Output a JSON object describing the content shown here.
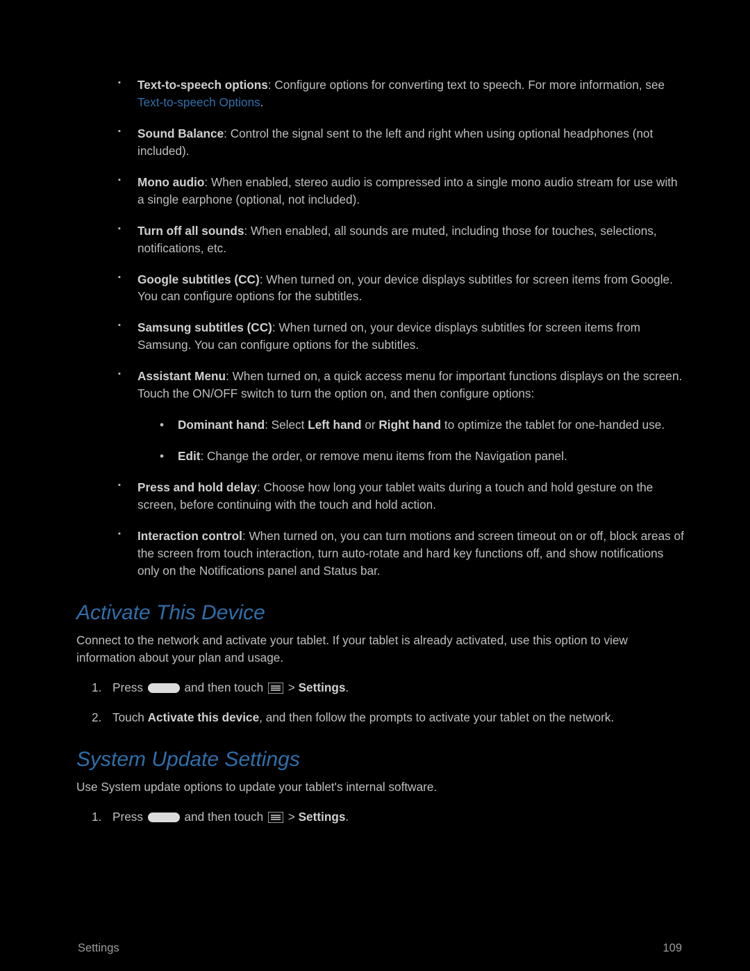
{
  "bullets": [
    {
      "term": "Text-to-speech options",
      "text_a": ": Configure options for converting text to speech. For more information, see ",
      "link": "Text-to-speech Options",
      "text_b": "."
    },
    {
      "term": "Sound Balance",
      "text": ": Control the signal sent to the left and right when using optional headphones (not included)."
    },
    {
      "term": "Mono audio",
      "text": ": When enabled, stereo audio is compressed into a single mono audio stream for use with a single earphone (optional, not included)."
    },
    {
      "term": "Turn off all sounds",
      "text": ": When enabled, all sounds are muted, including those for touches, selections, notifications, etc."
    },
    {
      "term": "Google subtitles (CC)",
      "text": ": When turned on, your device displays subtitles for screen items from Google. You can configure options for the subtitles."
    },
    {
      "term": "Samsung subtitles (CC)",
      "text": ": When turned on, your device displays subtitles for screen items from Samsung. You can configure options for the subtitles."
    },
    {
      "term": "Assistant Menu",
      "text": ": When turned on, a quick access menu for important functions displays on the screen. Touch the ON/OFF switch to turn the option on, and then configure options:",
      "sub": [
        {
          "term": "Dominant hand",
          "t1": ": Select ",
          "b1": "Left hand",
          "t2": " or ",
          "b2": "Right hand",
          "t3": " to optimize the tablet for one-handed use."
        },
        {
          "term": "Edit",
          "text": ": Change the order, or remove menu items from the Navigation panel."
        }
      ]
    },
    {
      "term": "Press and hold delay",
      "text": ": Choose how long your tablet waits during a touch and hold gesture on the screen, before continuing with the touch and hold action."
    },
    {
      "term": "Interaction control",
      "text": ": When turned on, you can turn motions and screen timeout on or off, block areas of the screen from touch interaction, turn auto-rotate and hard key functions off, and show notifications only on the Notifications panel and Status bar."
    }
  ],
  "section1": {
    "heading": "Activate This Device",
    "intro": "Connect to the network and activate your tablet. If your tablet is already activated, use this option to view information about your plan and usage.",
    "steps": [
      {
        "n": "1.",
        "pre": "Press ",
        "mid": " and then touch ",
        "post_sep": " > ",
        "post_bold": "Settings",
        "tail": "."
      },
      {
        "n": "2.",
        "pre": "Touch ",
        "bold": "Activate this device",
        "tail": ", and then follow the prompts to activate your tablet on the network."
      }
    ]
  },
  "section2": {
    "heading": "System Update Settings",
    "intro": "Use System update options to update your tablet's internal software.",
    "steps": [
      {
        "n": "1.",
        "pre": "Press ",
        "mid": " and then touch ",
        "post_sep": " > ",
        "post_bold": "Settings",
        "tail": "."
      }
    ]
  },
  "footer": {
    "label": "Settings",
    "page": "109"
  }
}
